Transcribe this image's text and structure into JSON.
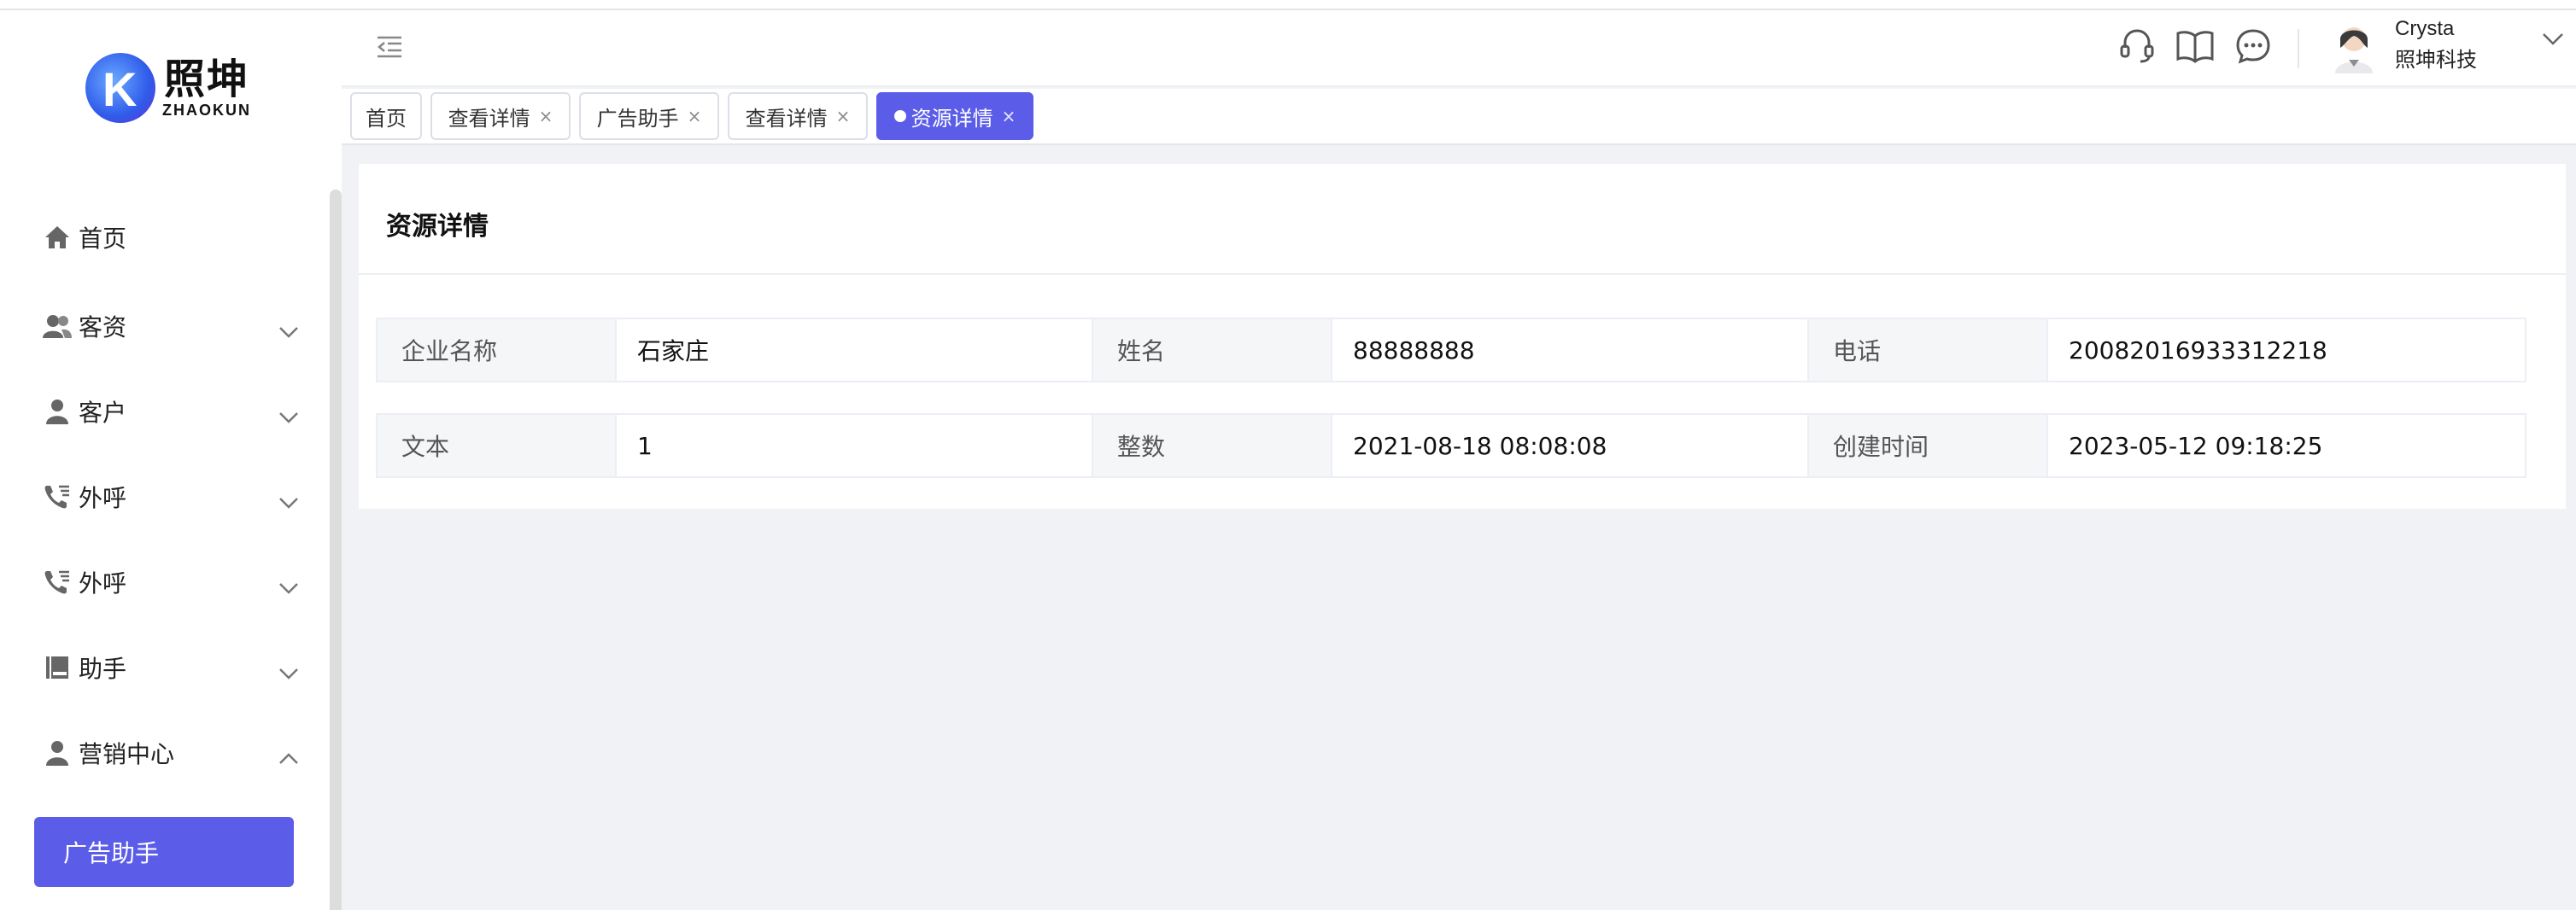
{
  "logo": {
    "cn": "照坤",
    "en": "ZHAOKUN"
  },
  "sidebar": {
    "items": [
      {
        "label": "首页",
        "icon": "home-icon"
      },
      {
        "label": "客资",
        "icon": "users-icon"
      },
      {
        "label": "客户",
        "icon": "user-icon"
      },
      {
        "label": "外呼",
        "icon": "phone-icon"
      },
      {
        "label": "外呼",
        "icon": "phone-icon"
      },
      {
        "label": "助手",
        "icon": "book-icon"
      },
      {
        "label": "营销中心",
        "icon": "user-icon"
      }
    ],
    "active_sub": "广告助手"
  },
  "header": {
    "user_name": "Crysta",
    "user_company": "照坤科技"
  },
  "tabs": [
    {
      "label": "首页",
      "closable": false
    },
    {
      "label": "查看详情",
      "closable": true
    },
    {
      "label": "广告助手",
      "closable": true
    },
    {
      "label": "查看详情",
      "closable": true
    },
    {
      "label": "资源详情",
      "closable": true,
      "active": true
    }
  ],
  "detail": {
    "title": "资源详情",
    "rows": [
      [
        {
          "label": "企业名称",
          "value": "石家庄"
        },
        {
          "label": "姓名",
          "value": "88888888"
        },
        {
          "label": "电话",
          "value": "20082016933312218"
        }
      ],
      [
        {
          "label": "文本",
          "value": "1"
        },
        {
          "label": "整数",
          "value": "2021-08-18 08:08:08"
        },
        {
          "label": "创建时间",
          "value": "2023-05-12 09:18:25"
        }
      ]
    ]
  },
  "colors": {
    "accent": "#5b5de8",
    "background": "#f0f2f5"
  }
}
